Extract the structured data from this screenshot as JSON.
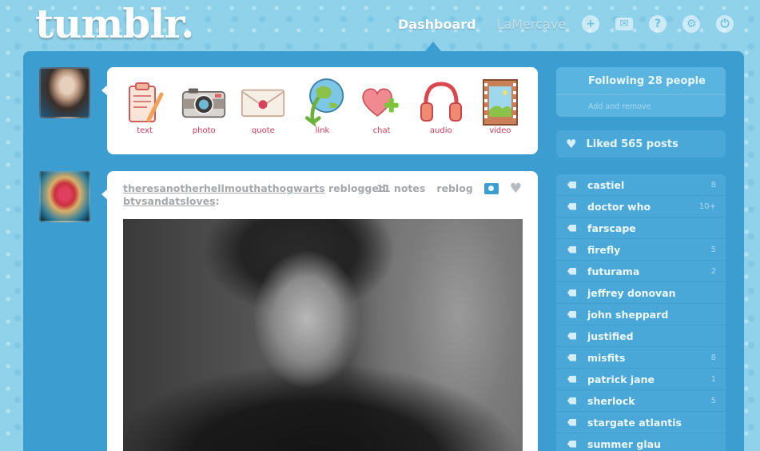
{
  "header": {
    "logo": "tumblr.",
    "nav": {
      "dashboard": "Dashboard",
      "blog": "LaMercave",
      "icons": [
        "new-post-icon",
        "messages-icon",
        "help-icon",
        "settings-icon",
        "logout-icon"
      ]
    }
  },
  "post_types": [
    {
      "label": "text",
      "icon": "clipboard-icon"
    },
    {
      "label": "photo",
      "icon": "camera-icon"
    },
    {
      "label": "quote",
      "icon": "envelope-icon"
    },
    {
      "label": "link",
      "icon": "globe-arrow-icon"
    },
    {
      "label": "chat",
      "icon": "heart-plus-icon"
    },
    {
      "label": "audio",
      "icon": "headphones-icon"
    },
    {
      "label": "video",
      "icon": "film-icon"
    }
  ],
  "post": {
    "author": "theresanotherhellmouthathogwarts",
    "action": "reblogged",
    "source": "btvsandatsloves",
    "suffix": ":",
    "notes": "11 notes",
    "reblog": "reblog"
  },
  "sidebar": {
    "following": "Following 28 people",
    "following_sub": "Add and remove",
    "liked": "Liked 565 posts",
    "tags": [
      {
        "name": "castiel",
        "count": "8"
      },
      {
        "name": "doctor who",
        "count": "10+"
      },
      {
        "name": "farscape",
        "count": ""
      },
      {
        "name": "firefly",
        "count": "5"
      },
      {
        "name": "futurama",
        "count": "2"
      },
      {
        "name": "jeffrey donovan",
        "count": ""
      },
      {
        "name": "john sheppard",
        "count": ""
      },
      {
        "name": "justified",
        "count": ""
      },
      {
        "name": "misfits",
        "count": "8"
      },
      {
        "name": "patrick jane",
        "count": "1"
      },
      {
        "name": "sherlock",
        "count": "5"
      },
      {
        "name": "stargate atlantis",
        "count": ""
      },
      {
        "name": "summer glau",
        "count": ""
      }
    ]
  },
  "colors": {
    "background": "#8fd2ea",
    "panel": "#3c9ed0",
    "sidebar_row": "#4aa8d8",
    "post_type_label": "#d23a5a"
  }
}
